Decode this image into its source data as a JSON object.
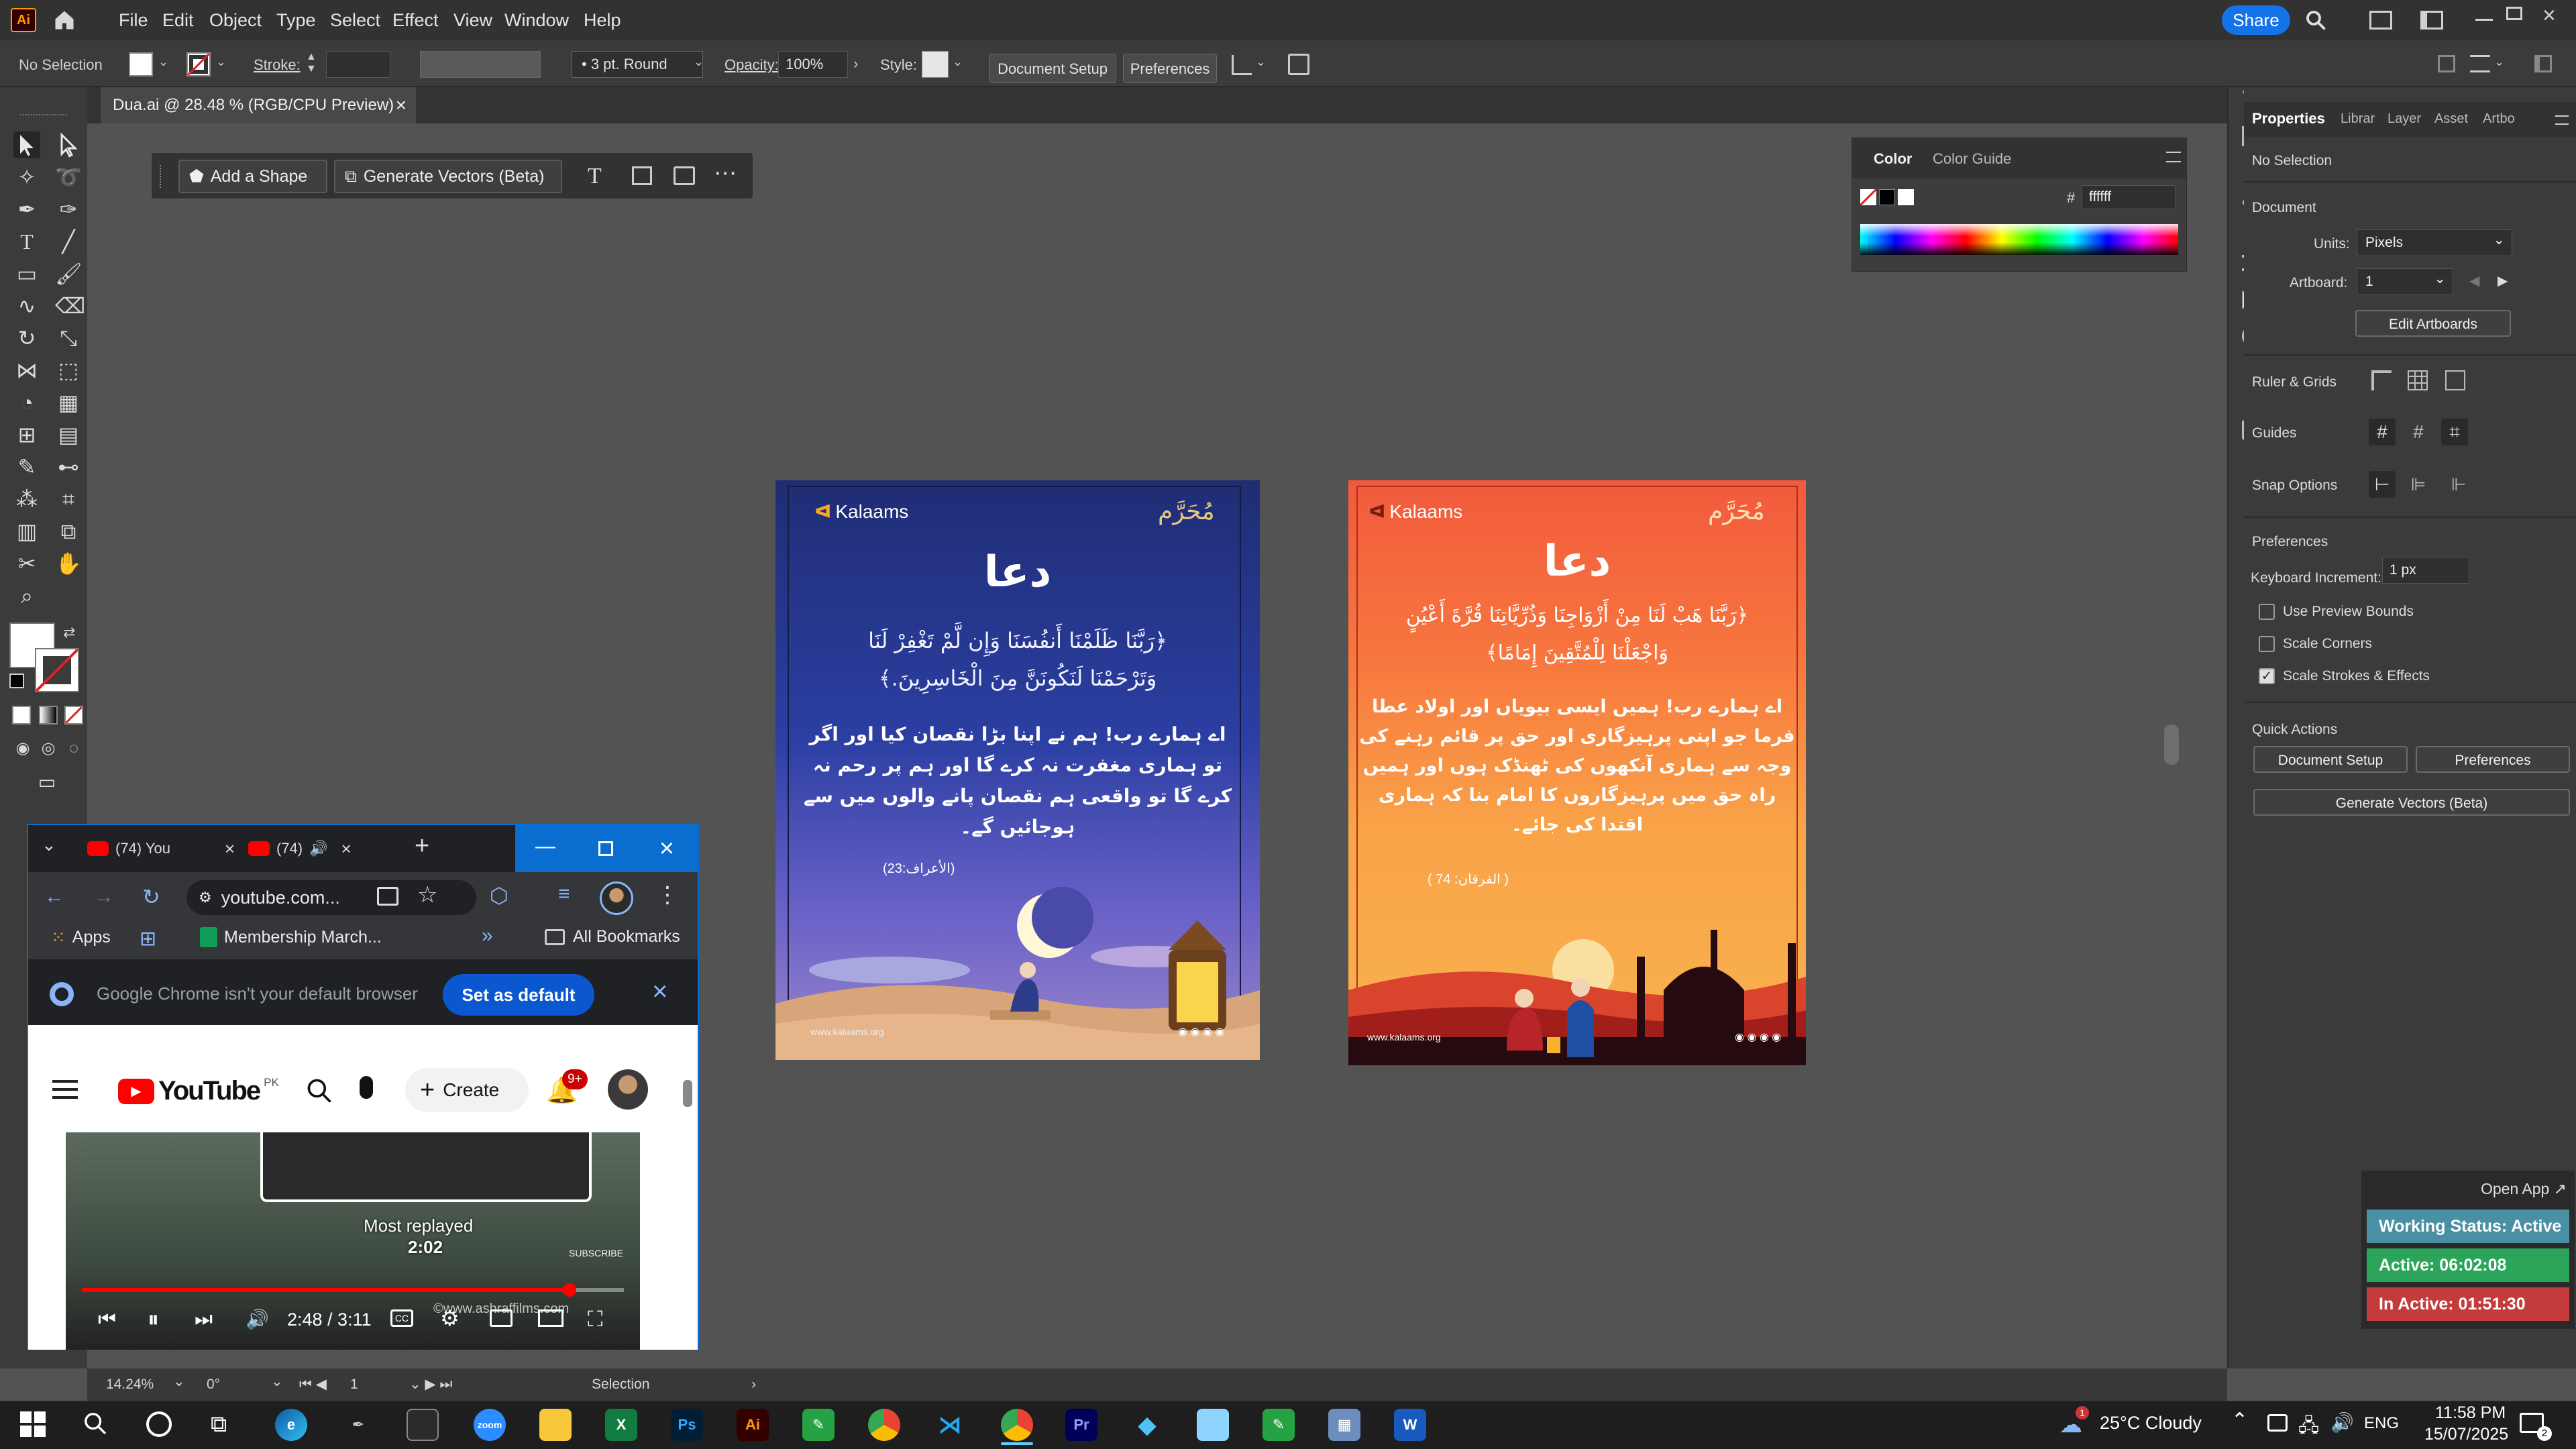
{
  "app": {
    "logo": "Ai",
    "menus": [
      "File",
      "Edit",
      "Object",
      "Type",
      "Select",
      "Effect",
      "View",
      "Window",
      "Help"
    ],
    "share_label": "Share"
  },
  "control_bar": {
    "selection": "No Selection",
    "stroke_label": "Stroke:",
    "brush": "3 pt. Round",
    "opacity_label": "Opacity:",
    "opacity_value": "100%",
    "style_label": "Style:",
    "document_setup": "Document Setup",
    "preferences": "Preferences"
  },
  "document_tab": {
    "title": "Dua.ai @ 28.48 % (RGB/CPU Preview)",
    "close": "×"
  },
  "context_toolbar": {
    "add_shape": "Add a Shape",
    "generate_vectors": "Generate Vectors (Beta)"
  },
  "color_panel": {
    "tabs": [
      "Color",
      "Color Guide"
    ],
    "hex_label": "#",
    "hex_value": "ffffff"
  },
  "properties_panel": {
    "tabs": [
      "Properties",
      "Librar",
      "Layer",
      "Asset",
      "Artbo"
    ],
    "selection": "No Selection",
    "document_header": "Document",
    "units_label": "Units:",
    "units_value": "Pixels",
    "artboard_label": "Artboard:",
    "artboard_value": "1",
    "edit_artboards": "Edit Artboards",
    "ruler_grids": "Ruler & Grids",
    "guides": "Guides",
    "snap_options": "Snap Options",
    "preferences_header": "Preferences",
    "keyboard_increment_label": "Keyboard Increment:",
    "keyboard_increment_value": "1 px",
    "use_preview_bounds": "Use Preview Bounds",
    "scale_corners": "Scale Corners",
    "scale_strokes": "Scale Strokes & Effects",
    "quick_actions": "Quick Actions",
    "qa_document_setup": "Document Setup",
    "qa_preferences": "Preferences",
    "qa_generate_vectors": "Generate Vectors (Beta)"
  },
  "artboard_blue": {
    "brand": "Kalaams",
    "muharram": "مُحَرَّم",
    "title": "دعا",
    "arabic_1": "﴿رَبَّنَا ظَلَمْنَا أَنفُسَنَا وَإِن لَّمْ تَغْفِرْ لَنَا",
    "arabic_2": "وَتَرْحَمْنَا لَنَكُونَنَّ مِنَ الْخَاسِرِينَ.﴾",
    "urdu_1": "اے ہمارے رب! ہم نے اپنا بڑا نقصان کیا اور اگر",
    "urdu_2": "تو ہماری مغفرت نہ کرے گا اور ہم پر رحم نہ",
    "urdu_3": "کرے گا تو واقعی ہم نقصان پانے والوں میں سے",
    "urdu_4": "ہوجائیں گے۔",
    "reference": "(الأعراف:23)",
    "website": "www.kalaams.org"
  },
  "artboard_orange": {
    "brand": "Kalaams",
    "muharram": "مُحَرَّم",
    "title": "دعا",
    "arabic_1": "﴿رَبَّنَا هَبْ لَنَا مِنْ أَزْوَاجِنَا وَذُرِّيَّاتِنَا قُرَّةَ أَعْيُنٍ",
    "arabic_2": "وَاجْعَلْنَا لِلْمُتَّقِينَ إِمَامًا﴾",
    "urdu_1": "اے ہمارے رب! ہمیں ایسی بیویاں اور اولاد عطا",
    "urdu_2": "فرما جو اپنی پرہیزگاری اور حق پر قائم رہنے کی",
    "urdu_3": "وجہ سے ہماری آنکھوں کی ٹھنڈک ہوں اور ہمیں",
    "urdu_4": "راہ حق میں پرہیزگاروں کا امام بنا کہ ہماری",
    "urdu_5": "اقتدا کی جائے۔",
    "reference": "( الفرقان: 74 )",
    "website": "www.kalaams.org"
  },
  "status_bar": {
    "zoom": "14.24%",
    "rotation": "0°",
    "artboard_num": "1",
    "tool": "Selection"
  },
  "chrome": {
    "tab1": "(74) You",
    "tab2": "(74)",
    "url": "youtube.com...",
    "bookmark_apps": "Apps",
    "bookmark_membership": "Membership March...",
    "all_bookmarks": "All Bookmarks",
    "infobar_text": "Google Chrome isn't your default browser",
    "set_default": "Set as default",
    "yt_logo": "YouTube",
    "yt_region": "PK",
    "create": "Create",
    "notif_count": "9+",
    "most_replayed": "Most replayed",
    "replay_time": "2:02",
    "time": "2:48 / 3:11",
    "watermark": "©www.ashraffilms.com",
    "subscribe": "SUBSCRIBE",
    "progress": 0.9
  },
  "tracker": {
    "open_app": "Open App ↗",
    "working_status": "Working Status: Active",
    "active": "Active: 06:02:08",
    "inactive": "In Active: 01:51:30"
  },
  "taskbar": {
    "weather": "25°C  Cloudy",
    "lang": "ENG",
    "time": "11:58 PM",
    "date": "15/07/2025",
    "notif_badge": "1",
    "action_badge": "2"
  }
}
